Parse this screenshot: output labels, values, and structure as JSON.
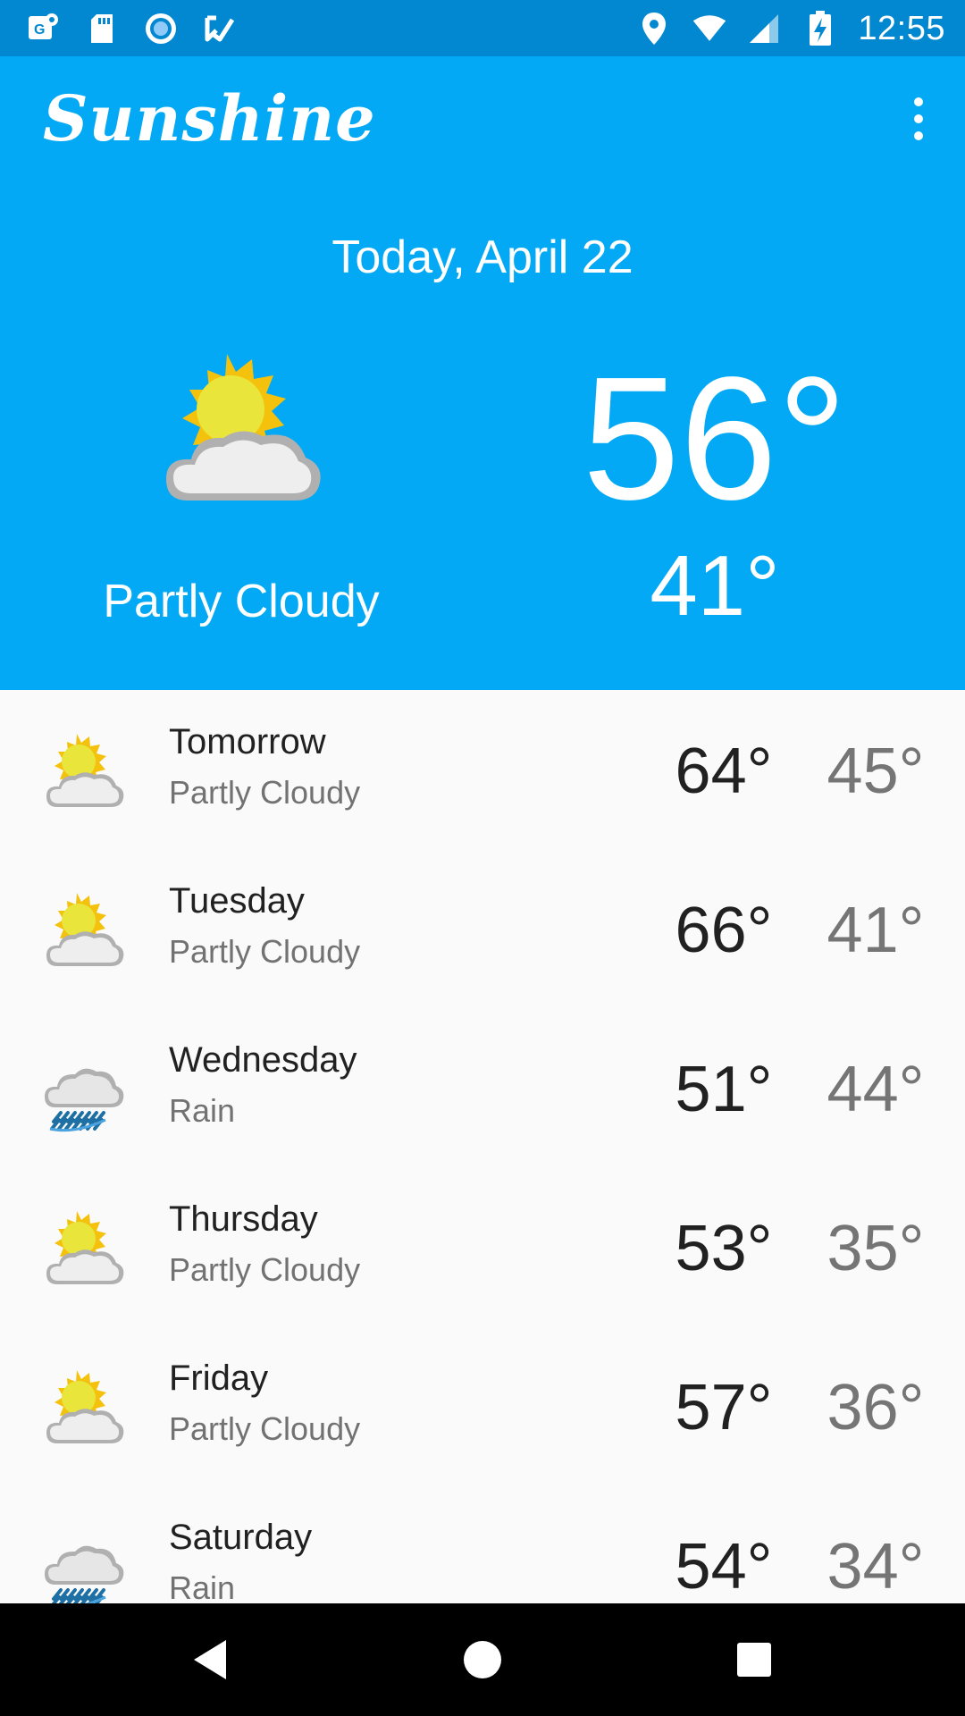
{
  "status_bar": {
    "time": "12:55",
    "left_icons": [
      "maps-notification-icon",
      "sd-card-icon",
      "record-icon",
      "task-check-icon"
    ],
    "right_icons": [
      "location-icon",
      "wifi-icon",
      "cell-signal-icon",
      "battery-charging-icon"
    ]
  },
  "app_bar": {
    "title": "Sunshine",
    "menu_icon": "more-vert-icon"
  },
  "today": {
    "date": "Today, April 22",
    "icon": "partly-cloudy-icon",
    "description": "Partly Cloudy",
    "high": "56°",
    "low": "41°"
  },
  "forecast": [
    {
      "day": "Tomorrow",
      "description": "Partly Cloudy",
      "icon": "partly-cloudy-icon",
      "high": "64°",
      "low": "45°"
    },
    {
      "day": "Tuesday",
      "description": "Partly Cloudy",
      "icon": "partly-cloudy-icon",
      "high": "66°",
      "low": "41°"
    },
    {
      "day": "Wednesday",
      "description": "Rain",
      "icon": "rain-icon",
      "high": "51°",
      "low": "44°"
    },
    {
      "day": "Thursday",
      "description": "Partly Cloudy",
      "icon": "partly-cloudy-icon",
      "high": "53°",
      "low": "35°"
    },
    {
      "day": "Friday",
      "description": "Partly Cloudy",
      "icon": "partly-cloudy-icon",
      "high": "57°",
      "low": "36°"
    },
    {
      "day": "Saturday",
      "description": "Rain",
      "icon": "rain-icon",
      "high": "54°",
      "low": "34°"
    }
  ],
  "nav_bar": {
    "buttons": [
      "back-icon",
      "home-icon",
      "recents-icon"
    ]
  },
  "colors": {
    "primary": "#03a9f4",
    "primary_dark": "#0288d1",
    "background": "#fafafa"
  }
}
